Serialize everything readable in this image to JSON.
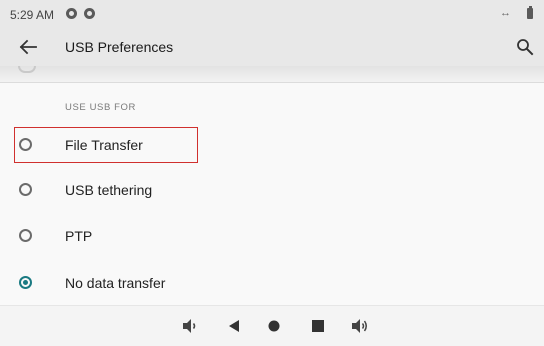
{
  "status_bar": {
    "time": "5:29 AM",
    "notification_icons": [
      "g-circle-icon",
      "g-circle-icon"
    ],
    "right_icons": [
      "sync-arrows-icon",
      "battery-icon"
    ]
  },
  "app_bar": {
    "title": "USB Preferences",
    "back_icon": "arrow-back-icon",
    "search_icon": "search-icon"
  },
  "section": {
    "header": "USE USB FOR"
  },
  "options": [
    {
      "label": "File Transfer",
      "checked": false
    },
    {
      "label": "USB tethering",
      "checked": false
    },
    {
      "label": "PTP",
      "checked": false
    },
    {
      "label": "No data transfer",
      "checked": true
    }
  ],
  "nav_bar": {
    "items": [
      "volume-down-icon",
      "back-triangle-icon",
      "home-circle-icon",
      "recents-square-icon",
      "volume-up-icon"
    ]
  },
  "colors": {
    "accent": "#1a7a82",
    "highlight": "#d0302e",
    "app_bar": "#e8e8e8",
    "background": "#f9f9f9"
  }
}
